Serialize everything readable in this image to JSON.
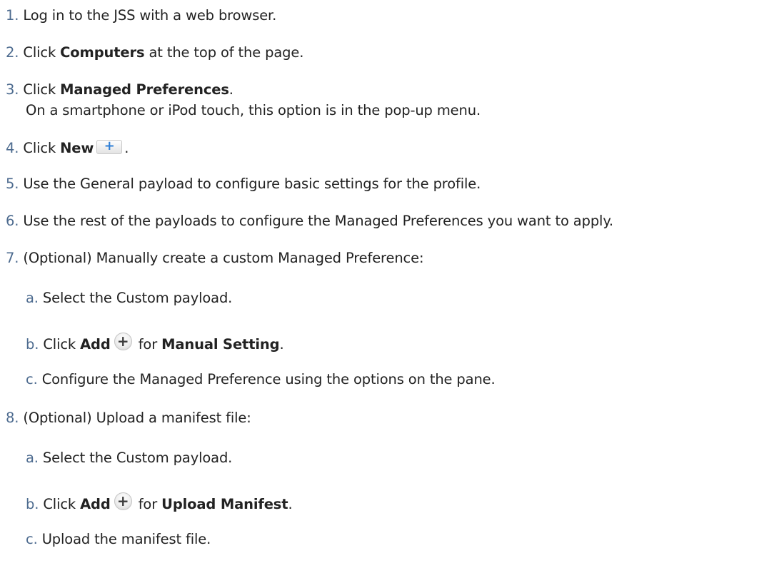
{
  "steps": [
    {
      "num": "1.",
      "text": "Log in to the JSS with a web browser."
    },
    {
      "num": "2.",
      "pre": "Click ",
      "bold": "Computers",
      "post": " at the top of the page."
    },
    {
      "num": "3.",
      "pre": "Click ",
      "bold": "Managed Preferences",
      "post": ".",
      "note": "On a smartphone or iPod touch, this option is in the pop-up menu."
    },
    {
      "num": "4.",
      "pre": "Click ",
      "bold": "New",
      "post": "."
    },
    {
      "num": "5.",
      "text": "Use the General payload to configure basic settings for the profile."
    },
    {
      "num": "6.",
      "text": "Use the rest of the payloads to configure the Managed Preferences you want to apply."
    },
    {
      "num": "7.",
      "text": "(Optional) Manually create a custom Managed Preference:",
      "substeps": [
        {
          "num": "a.",
          "text": "Select the Custom payload."
        },
        {
          "num": "b.",
          "pre": "Click ",
          "bold": "Add",
          "mid": " for ",
          "bold2": "Manual Setting",
          "post": "."
        },
        {
          "num": "c.",
          "text": "Configure the Managed Preference using the options on the pane."
        }
      ]
    },
    {
      "num": "8.",
      "text": "(Optional) Upload a manifest file:",
      "substeps": [
        {
          "num": "a.",
          "text": "Select the Custom payload."
        },
        {
          "num": "b.",
          "pre": "Click ",
          "bold": "Add",
          "mid": " for ",
          "bold2": "Upload Manifest",
          "post": "."
        },
        {
          "num": "c.",
          "text": "Upload the manifest file."
        }
      ]
    }
  ],
  "icons": {
    "new_button": "plus-icon",
    "add_button": "plus-circle-icon"
  },
  "colors": {
    "number": "#4d6b8f",
    "text": "#222222",
    "plus_blue": "#2f7fd6"
  }
}
